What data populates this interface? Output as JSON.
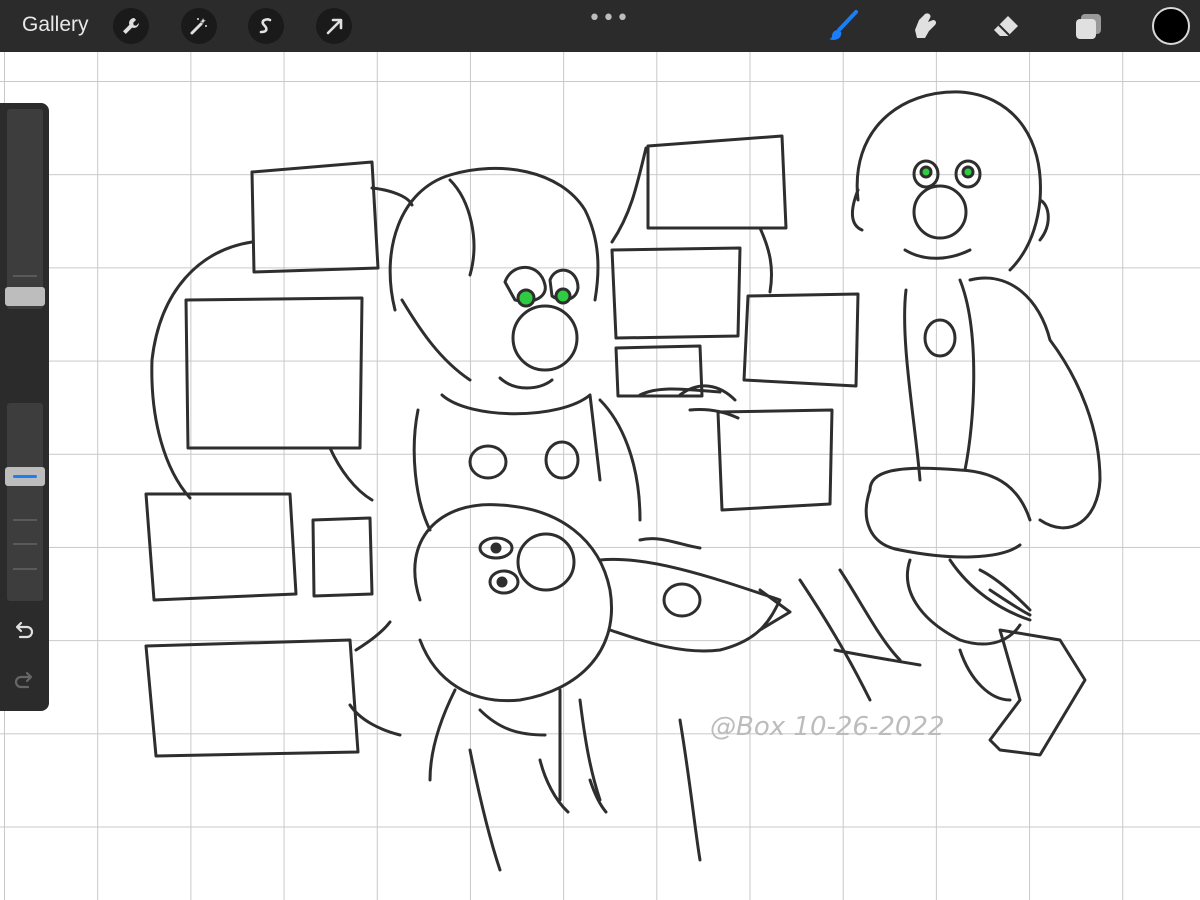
{
  "app": {
    "gallery_label": "Gallery",
    "more_menu": "•••"
  },
  "toolbar": {
    "left_tools": [
      "wrench-icon",
      "magic-wand-icon",
      "selection-icon",
      "transform-arrow-icon"
    ],
    "right_tools": [
      "brush-icon",
      "smudge-icon",
      "eraser-icon",
      "layers-icon"
    ],
    "active_tool": "brush-icon",
    "accent_color": "#1a7ef6",
    "current_color": "#000000"
  },
  "sidebar": {
    "brush_size_level": 0.19,
    "opacity_level": 0.62,
    "modify_button": "square-icon",
    "undo": "undo-icon",
    "redo": "redo-icon"
  },
  "canvas": {
    "signature": "@Box 10-26-2022"
  }
}
